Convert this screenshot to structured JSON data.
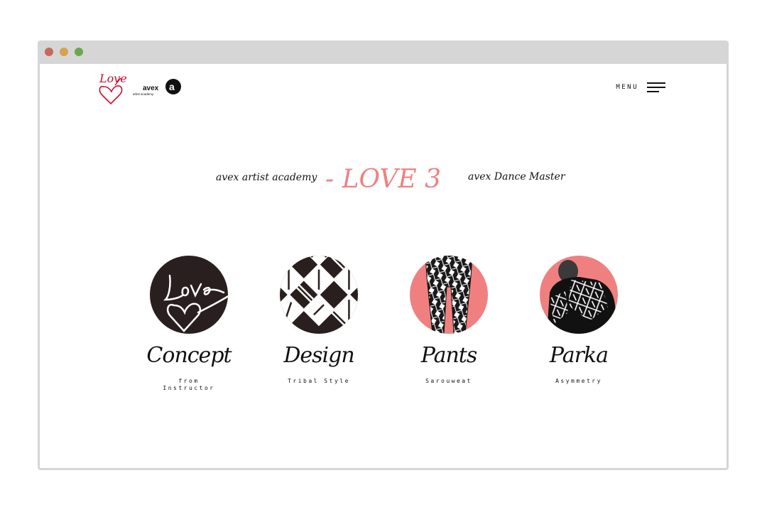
{
  "window": {
    "controls": [
      "close",
      "minimize",
      "maximize"
    ]
  },
  "header": {
    "logo_love_text": "Love",
    "logo_avex_text": "avex",
    "logo_avex_sub": "artist academy",
    "menu_label": "MENU"
  },
  "hero": {
    "left_text": "avex artist academy",
    "title": "- LOVE 3 -",
    "right_text": "avex Dance Master"
  },
  "cards": [
    {
      "title": "Concept",
      "subtitle": "from\nInstructor",
      "icon": "love-heart-graphic"
    },
    {
      "title": "Design",
      "subtitle": "Tribal Style",
      "icon": "tribal-pattern-graphic"
    },
    {
      "title": "Pants",
      "subtitle": "Sarouweat",
      "icon": "pants-photo"
    },
    {
      "title": "Parka",
      "subtitle": "Asymmetry",
      "icon": "parka-photo"
    }
  ],
  "colors": {
    "accent": "#f08080",
    "dark": "#2a1f1f",
    "frame": "#d6d6d6",
    "logo_red": "#c8102e"
  }
}
